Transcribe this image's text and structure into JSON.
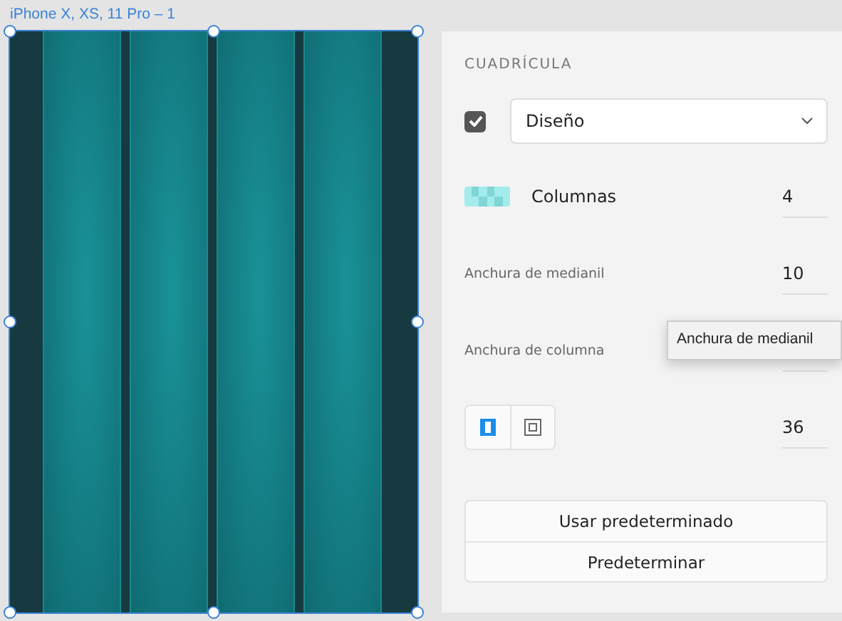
{
  "artboard": {
    "title": "iPhone X, XS, 11 Pro – 1",
    "selected": true
  },
  "grid": {
    "section_title": "CUADRÍCULA",
    "enabled": true,
    "type": {
      "value": "Diseño"
    },
    "fields": [
      {
        "kind": "columns",
        "label": "Columnas",
        "value": "4"
      },
      {
        "kind": "plain",
        "label": "Anchura de medianil",
        "value": "10"
      },
      {
        "kind": "plain",
        "label": "Anchura de columna"
      },
      {
        "kind": "margins",
        "value": "36"
      }
    ],
    "margin_modes": [
      {
        "kind": "linked",
        "selected": true
      },
      {
        "kind": "separate",
        "selected": false
      }
    ],
    "buttons": [
      "Usar predeterminado",
      "Predeterminar"
    ]
  },
  "tooltip": {
    "text": "Anchura de medianil"
  }
}
